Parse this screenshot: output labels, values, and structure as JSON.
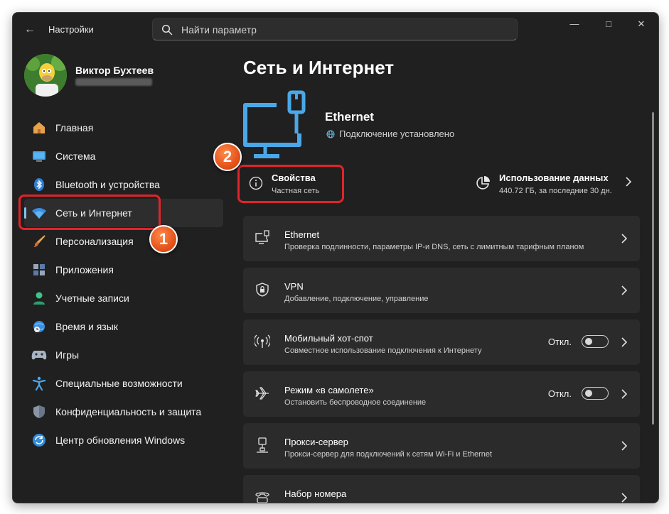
{
  "window": {
    "app_title": "Настройки",
    "search_placeholder": "Найти параметр",
    "controls": [
      "minimize",
      "maximize",
      "close"
    ]
  },
  "profile": {
    "name": "Виктор Бухтеев"
  },
  "sidebar": {
    "items": [
      {
        "label": "Главная",
        "icon": "home-icon"
      },
      {
        "label": "Система",
        "icon": "system-icon"
      },
      {
        "label": "Bluetooth и устройства",
        "icon": "bluetooth-icon"
      },
      {
        "label": "Сеть и Интернет",
        "icon": "wifi-icon",
        "active": true
      },
      {
        "label": "Персонализация",
        "icon": "brush-icon"
      },
      {
        "label": "Приложения",
        "icon": "apps-icon"
      },
      {
        "label": "Учетные записи",
        "icon": "account-icon"
      },
      {
        "label": "Время и язык",
        "icon": "globe-clock-icon"
      },
      {
        "label": "Игры",
        "icon": "gamepad-icon"
      },
      {
        "label": "Специальные возможности",
        "icon": "accessibility-icon"
      },
      {
        "label": "Конфиденциальность и защита",
        "icon": "shield-icon"
      },
      {
        "label": "Центр обновления Windows",
        "icon": "update-icon"
      }
    ]
  },
  "main": {
    "title": "Сеть и Интернет",
    "connection": {
      "name": "Ethernet",
      "status": "Подключение установлено"
    },
    "properties": {
      "title": "Свойства",
      "subtitle": "Частная сеть"
    },
    "data_usage": {
      "title": "Использование данных",
      "subtitle": "440.72 ГБ, за последние 30 дн."
    },
    "rows": [
      {
        "title": "Ethernet",
        "subtitle": "Проверка подлинности, параметры IP-и DNS, сеть с лимитным тарифным планом",
        "icon": "ethernet-icon"
      },
      {
        "title": "VPN",
        "subtitle": "Добавление, подключение, управление",
        "icon": "vpn-shield-icon"
      },
      {
        "title": "Мобильный хот-спот",
        "subtitle": "Совместное использование подключения к Интернету",
        "icon": "hotspot-icon",
        "toggle_label": "Откл."
      },
      {
        "title": "Режим «в самолете»",
        "subtitle": "Остановить беспроводное соединение",
        "icon": "airplane-icon",
        "toggle_label": "Откл."
      },
      {
        "title": "Прокси-сервер",
        "subtitle": "Прокси-сервер для подключений к сетям Wi-Fi и Ethernet",
        "icon": "proxy-icon"
      },
      {
        "title": "Набор номера",
        "subtitle": "",
        "icon": "dialup-icon"
      }
    ]
  },
  "annotations": {
    "badge_1": "1",
    "badge_2": "2",
    "callout_color": "#e0242b",
    "badge_color": "#e5531a"
  },
  "colors": {
    "window_bg": "#202020",
    "card_bg": "#2b2b2b",
    "accent": "#7ec4f0",
    "ethernet_icon": "#4aa8e8"
  }
}
